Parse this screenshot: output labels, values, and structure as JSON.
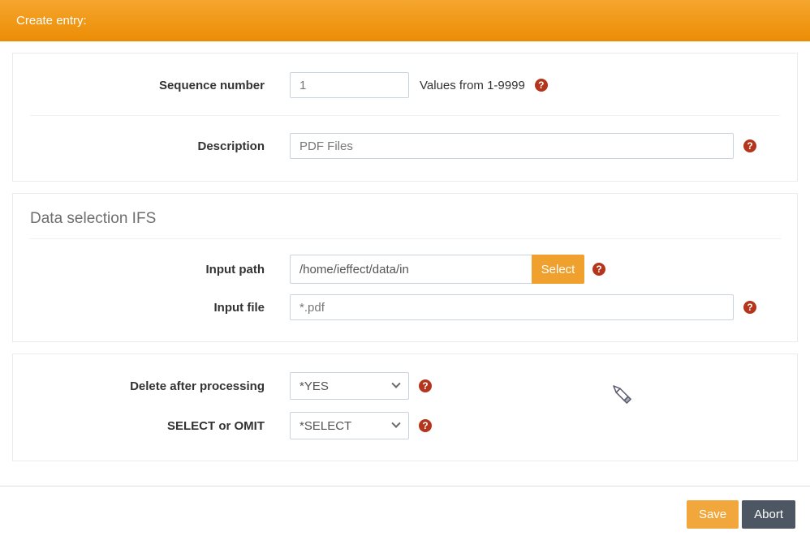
{
  "header": {
    "title": "Create entry:"
  },
  "general": {
    "sequence": {
      "label": "Sequence number",
      "value": "1",
      "hint": "Values from 1-9999"
    },
    "description": {
      "label": "Description",
      "value": "PDF Files"
    }
  },
  "data_selection": {
    "title": "Data selection IFS",
    "input_path": {
      "label": "Input path",
      "value": "/home/ieffect/data/in",
      "button_label": "Select"
    },
    "input_file": {
      "label": "Input file",
      "value": "*.pdf"
    }
  },
  "options": {
    "delete_after_processing": {
      "label": "Delete after processing",
      "value": "*YES"
    },
    "select_or_omit": {
      "label": "SELECT or OMIT",
      "value": "*SELECT"
    }
  },
  "footer": {
    "save_label": "Save",
    "abort_label": "Abort"
  },
  "icons": {
    "help_glyph": "?"
  },
  "colors": {
    "header_gradient_top": "#f5a62e",
    "header_gradient_bottom": "#ec8c05",
    "select_button_orange": "#efa02d",
    "save_button_orange": "#f2a73c",
    "abort_button_slate": "#4c5763",
    "help_icon_red": "#b5351c",
    "input_border": "#c9d3df",
    "panel_border": "#e9ebee"
  }
}
